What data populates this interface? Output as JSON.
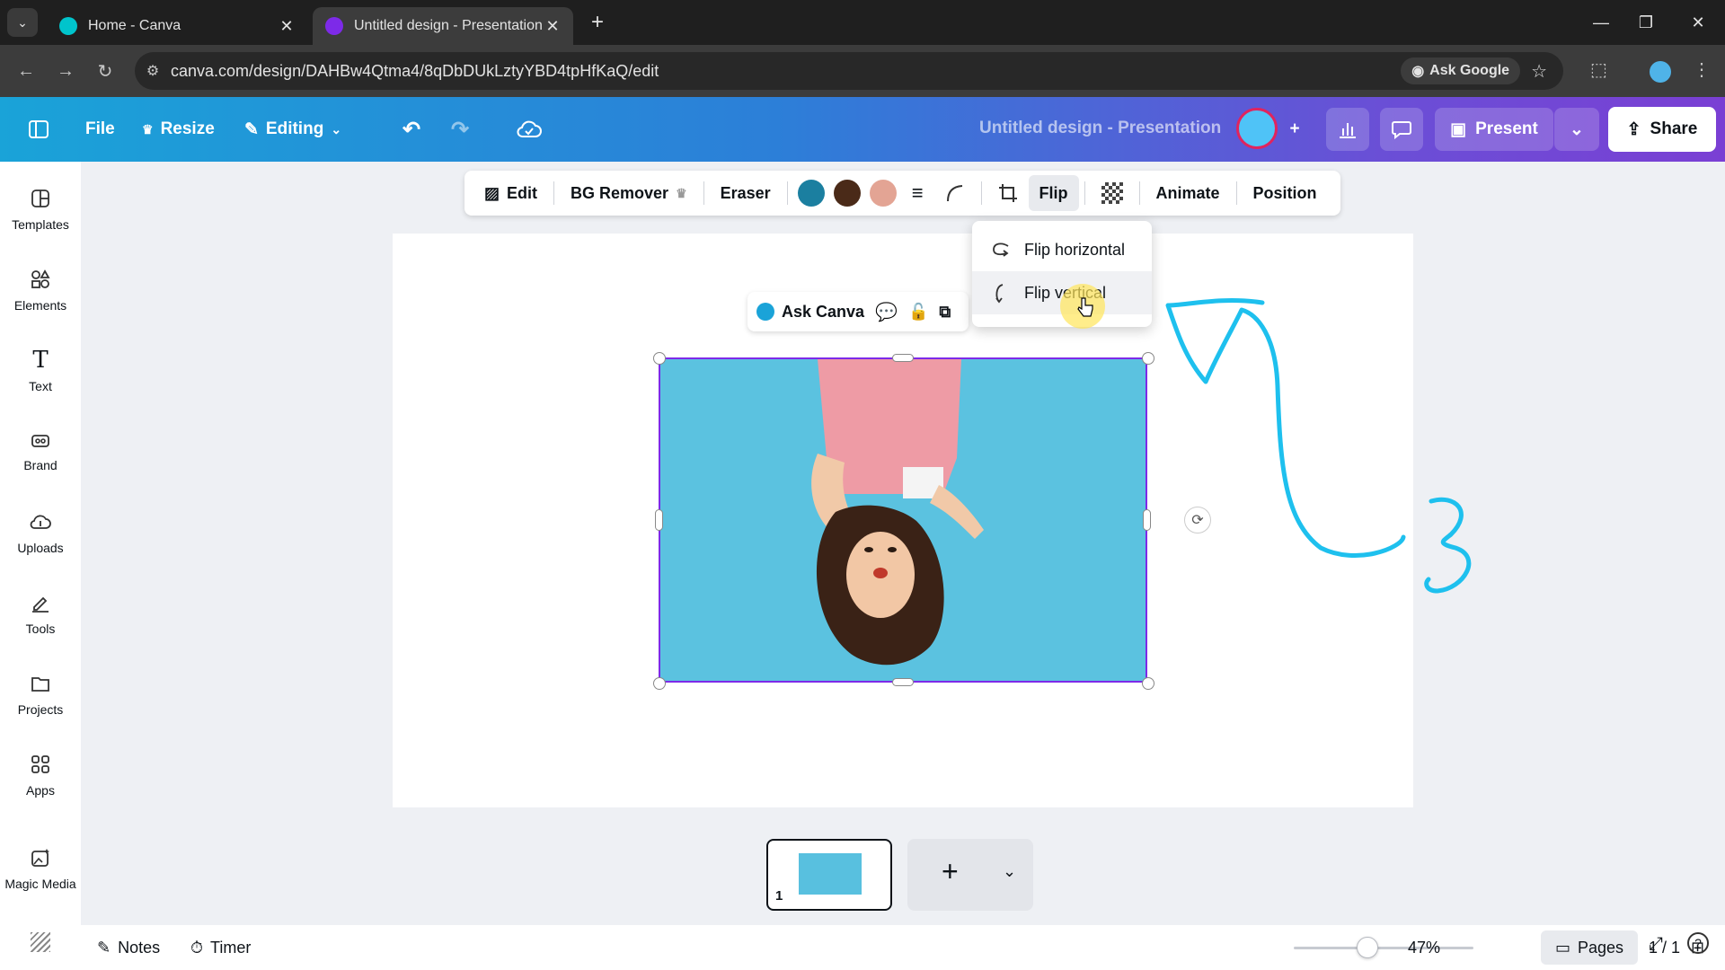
{
  "browser": {
    "tabs": [
      {
        "title": "Home - Canva",
        "active": false
      },
      {
        "title": "Untitled design - Presentation",
        "active": true
      }
    ],
    "url": "canva.com/design/DAHBw4Qtma4/8qDbDUkLztyYBD4tpHfKaQ/edit",
    "ask_google_label": "Ask Google"
  },
  "canva_header": {
    "file_label": "File",
    "resize_label": "Resize",
    "editing_label": "Editing",
    "document_title": "Untitled design - Presentation",
    "present_label": "Present",
    "share_label": "Share"
  },
  "left_rail": {
    "items": [
      {
        "label": "Templates",
        "icon": "templates-icon"
      },
      {
        "label": "Elements",
        "icon": "elements-icon"
      },
      {
        "label": "Text",
        "icon": "text-icon"
      },
      {
        "label": "Brand",
        "icon": "brand-icon"
      },
      {
        "label": "Uploads",
        "icon": "uploads-icon"
      },
      {
        "label": "Tools",
        "icon": "tools-icon"
      },
      {
        "label": "Projects",
        "icon": "projects-icon"
      },
      {
        "label": "Apps",
        "icon": "apps-icon"
      },
      {
        "label": "Magic Media",
        "icon": "magic-media-icon"
      }
    ]
  },
  "context_toolbar": {
    "edit_label": "Edit",
    "bg_remover_label": "BG Remover",
    "eraser_label": "Eraser",
    "swatches": [
      "#1b7fa0",
      "#4a2a18",
      "#e3a494"
    ],
    "flip_label": "Flip",
    "animate_label": "Animate",
    "position_label": "Position"
  },
  "flip_menu": {
    "items": [
      {
        "label": "Flip horizontal",
        "icon": "flip-horizontal-icon"
      },
      {
        "label": "Flip vertical",
        "icon": "flip-vertical-icon"
      }
    ]
  },
  "ask_canva": {
    "label": "Ask Canva"
  },
  "pages_strip": {
    "page_number": "1"
  },
  "footer": {
    "notes_label": "Notes",
    "timer_label": "Timer",
    "zoom": "47%",
    "pages_label": "Pages",
    "page_count": "1 / 1"
  },
  "colors": {
    "brand_gradient_start": "#1aa3d8",
    "brand_gradient_end": "#7a3fd4",
    "selection": "#7d2ae8",
    "annotation_stroke": "#1ec0ee"
  }
}
